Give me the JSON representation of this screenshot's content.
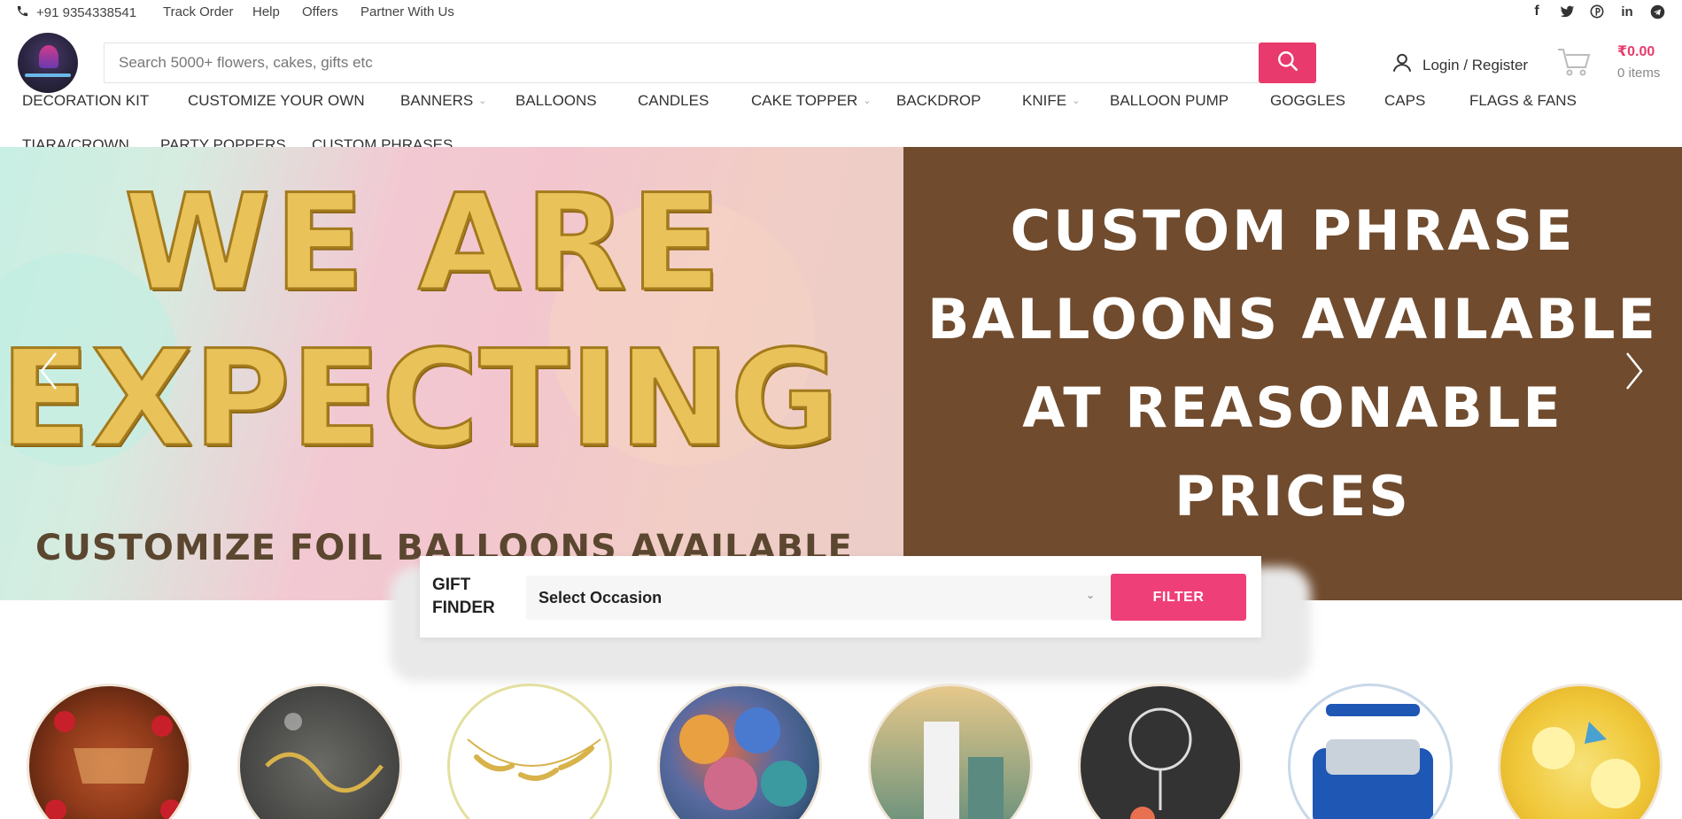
{
  "topbar": {
    "phone": "+91 9354338541",
    "links": [
      "Track Order",
      "Help",
      "Offers",
      "Partner With Us"
    ],
    "social_icons": [
      "facebook-icon",
      "twitter-icon",
      "pinterest-icon",
      "linkedin-icon",
      "telegram-icon"
    ]
  },
  "header": {
    "search_placeholder": "Search 5000+ flowers, cakes, gifts etc",
    "search_value": "",
    "login_label": "Login / Register",
    "cart_amount": "₹0.00",
    "cart_items": "0 items"
  },
  "nav": {
    "items": [
      {
        "label": "DECORATION KIT",
        "dropdown": false
      },
      {
        "label": "CUSTOMIZE YOUR OWN",
        "dropdown": false
      },
      {
        "label": "BANNERS",
        "dropdown": true
      },
      {
        "label": "BALLOONS",
        "dropdown": false
      },
      {
        "label": "CANDLES",
        "dropdown": false
      },
      {
        "label": "CAKE TOPPER",
        "dropdown": true
      },
      {
        "label": "BACKDROP",
        "dropdown": false
      },
      {
        "label": "KNIFE",
        "dropdown": true
      },
      {
        "label": "BALLOON PUMP",
        "dropdown": false
      },
      {
        "label": "GOGGLES",
        "dropdown": false
      },
      {
        "label": "CAPS",
        "dropdown": false
      },
      {
        "label": "FLAGS & FANS",
        "dropdown": false
      },
      {
        "label": "TIARA/CROWN",
        "dropdown": false
      },
      {
        "label": "PARTY POPPERS",
        "dropdown": false
      },
      {
        "label": "CUSTOM PHRASES",
        "dropdown": false
      }
    ]
  },
  "hero": {
    "left_line1": "WE ARE",
    "left_line2": "EXPECTING",
    "left_tagline": "CUSTOMIZE FOIL BALLOONS AVAILABLE",
    "right_lines": [
      "CUSTOM PHRASE",
      "BALLOONS AVAILABLE",
      "AT REASONABLE",
      "PRICES"
    ]
  },
  "gift_finder": {
    "label": "GIFT FINDER",
    "select_value": "Select Occasion",
    "button_label": "FILTER"
  },
  "colors": {
    "accent": "#e83a6c",
    "hero_brown": "#704b2e",
    "hero_gold": "#e9c35a"
  }
}
